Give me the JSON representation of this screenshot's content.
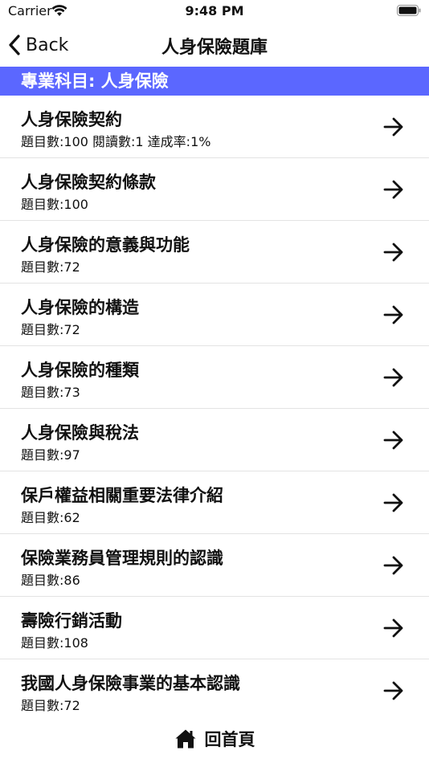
{
  "status_bar": {
    "carrier": "Carrier",
    "time": "9:48 PM"
  },
  "nav": {
    "back_label": "Back",
    "title": "人身保險題庫"
  },
  "section": {
    "header": "專業科目: 人身保險"
  },
  "rows": [
    {
      "title": "人身保險契約",
      "subtitle": "題目數:100 閱讀數:1 達成率:1%"
    },
    {
      "title": "人身保險契約條款",
      "subtitle": "題目數:100"
    },
    {
      "title": "人身保險的意義與功能",
      "subtitle": "題目數:72"
    },
    {
      "title": "人身保險的構造",
      "subtitle": "題目數:72"
    },
    {
      "title": "人身保險的種類",
      "subtitle": "題目數:73"
    },
    {
      "title": "人身保險與稅法",
      "subtitle": "題目數:97"
    },
    {
      "title": "保戶權益相關重要法律介紹",
      "subtitle": "題目數:62"
    },
    {
      "title": "保險業務員管理規則的認識",
      "subtitle": "題目數:86"
    },
    {
      "title": "壽險行銷活動",
      "subtitle": "題目數:108"
    },
    {
      "title": "我國人身保險事業的基本認識",
      "subtitle": "題目數:72"
    }
  ],
  "footer": {
    "home_label": "回首頁"
  },
  "colors": {
    "accent": "#5b67ff",
    "text": "#111111",
    "separator": "#e3e3e3"
  },
  "icons": {
    "back": "chevron-left-icon",
    "row": "arrow-right-icon",
    "home": "home-icon"
  }
}
